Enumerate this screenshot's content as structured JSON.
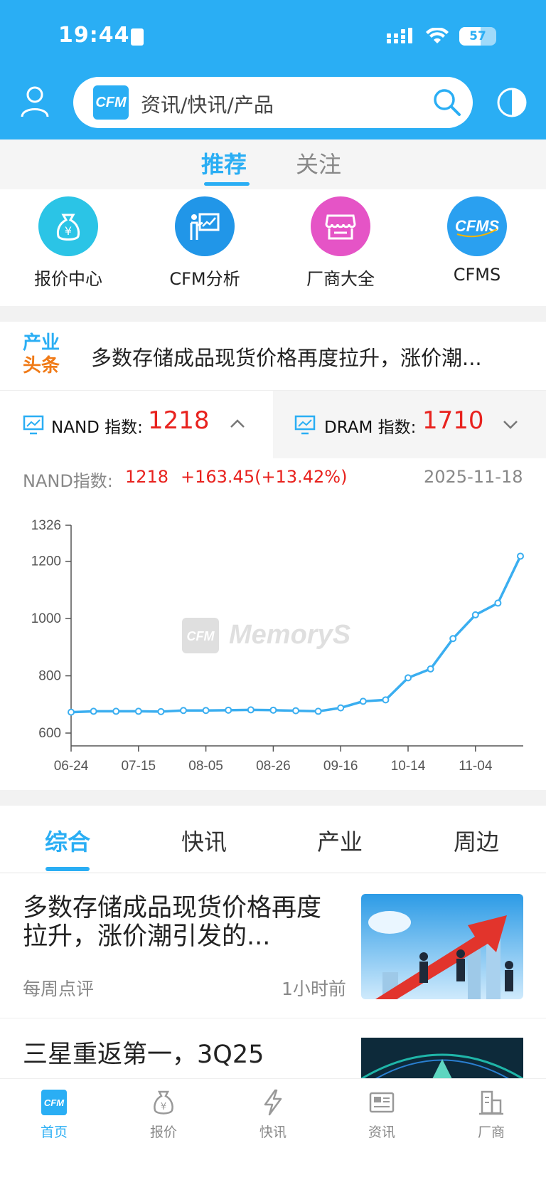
{
  "status": {
    "time": "19:44",
    "battery": "57",
    "battery_level": 0.57
  },
  "search": {
    "logo": "CFM",
    "placeholder": "资讯/快讯/产品"
  },
  "top_tabs": [
    {
      "label": "推荐",
      "active": true
    },
    {
      "label": "关注",
      "active": false
    }
  ],
  "shortcuts": [
    {
      "label": "报价中心",
      "icon": "money-bag-icon",
      "color": "#2bc4e6"
    },
    {
      "label": "CFM分析",
      "icon": "presentation-icon",
      "color": "#2196e8"
    },
    {
      "label": "厂商大全",
      "icon": "store-icon",
      "color": "#e554c6"
    },
    {
      "label": "CFMS",
      "icon": "cfms-logo-icon",
      "color": "#2aa0f0"
    }
  ],
  "headline": {
    "badge_top": "产业",
    "badge_bottom": "头条",
    "text": "多数存储成品现货价格再度拉升，涨价潮..."
  },
  "indices": {
    "nand": {
      "name": "NAND 指数:",
      "value": "1218"
    },
    "dram": {
      "name": "DRAM 指数:",
      "value": "1710"
    }
  },
  "summary": {
    "label": "NAND指数:",
    "value": "1218",
    "change": "+163.45(+13.42%)",
    "date": "2025-11-18"
  },
  "chart_data": {
    "type": "line",
    "watermark": "CFM MemoryS",
    "x_ticks": [
      "06-24",
      "07-15",
      "08-05",
      "08-26",
      "09-16",
      "10-14",
      "11-04"
    ],
    "y_ticks": [
      600,
      800,
      1000,
      1200,
      1326
    ],
    "ylim": [
      600,
      1326
    ],
    "series": [
      {
        "values": [
          673,
          676,
          676,
          676,
          675,
          679,
          679,
          680,
          681,
          680,
          678,
          676,
          688,
          711,
          716,
          793,
          824,
          930,
          1013,
          1054,
          1218
        ]
      }
    ],
    "line_color": "#3aaef0"
  },
  "content_tabs": [
    {
      "label": "综合",
      "active": true
    },
    {
      "label": "快讯"
    },
    {
      "label": "产业"
    },
    {
      "label": "周边"
    }
  ],
  "articles": [
    {
      "title": "多数存储成品现货价格再度拉升，涨价潮引发的...",
      "source": "每周点评",
      "time": "1小时前"
    },
    {
      "title": "三星重返第一，3Q25",
      "source": "",
      "time": ""
    }
  ],
  "bottom_nav": [
    {
      "label": "首页",
      "icon": "home-cfm-icon",
      "active": true
    },
    {
      "label": "报价",
      "icon": "money-bag-icon"
    },
    {
      "label": "快讯",
      "icon": "lightning-icon"
    },
    {
      "label": "资讯",
      "icon": "news-icon"
    },
    {
      "label": "厂商",
      "icon": "building-icon"
    }
  ],
  "colors": {
    "accent": "#2aaef4",
    "red": "#e8221e"
  }
}
